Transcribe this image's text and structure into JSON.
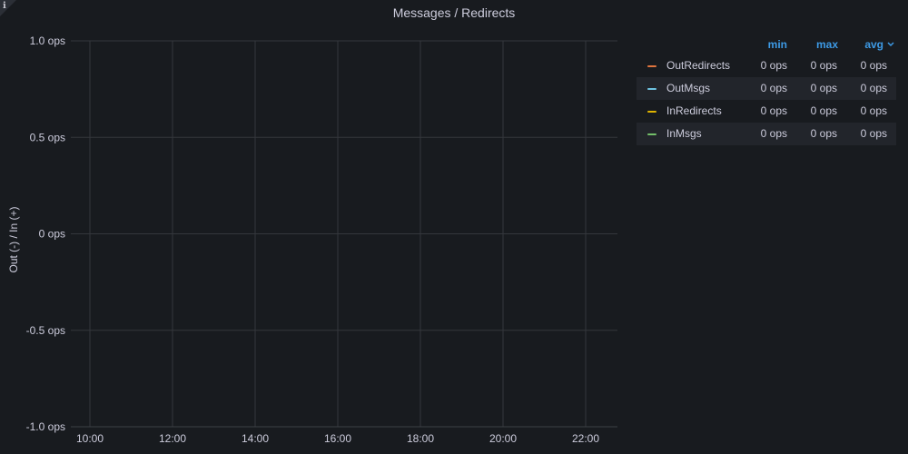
{
  "panel": {
    "title": "Messages / Redirects",
    "info_icon": "info-icon"
  },
  "legend": {
    "headers": {
      "min": "min",
      "max": "max",
      "avg": "avg"
    },
    "sort_icon": "chevron-down-icon",
    "rows": [
      {
        "name": "OutRedirects",
        "color": "#e0753e",
        "min": "0 ops",
        "max": "0 ops",
        "avg": "0 ops"
      },
      {
        "name": "OutMsgs",
        "color": "#6ec3e0",
        "min": "0 ops",
        "max": "0 ops",
        "avg": "0 ops"
      },
      {
        "name": "InRedirects",
        "color": "#e0b400",
        "min": "0 ops",
        "max": "0 ops",
        "avg": "0 ops"
      },
      {
        "name": "InMsgs",
        "color": "#73bf69",
        "min": "0 ops",
        "max": "0 ops",
        "avg": "0 ops"
      }
    ]
  },
  "chart_data": {
    "type": "line",
    "title": "Messages / Redirects",
    "ylabel": "Out (-) / In (+)",
    "xlabel": "",
    "ylim": [
      -1.0,
      1.0
    ],
    "y_ticks": [
      1.0,
      0.5,
      0,
      -0.5,
      -1.0
    ],
    "y_tick_labels": [
      "1.0 ops",
      "0.5 ops",
      "0 ops",
      "-0.5 ops",
      "-1.0 ops"
    ],
    "x_ticks": [
      "10:00",
      "12:00",
      "14:00",
      "16:00",
      "18:00",
      "20:00",
      "22:00"
    ],
    "grid": true,
    "legend_position": "right",
    "series": [
      {
        "name": "OutRedirects",
        "values": []
      },
      {
        "name": "OutMsgs",
        "values": []
      },
      {
        "name": "InRedirects",
        "values": []
      },
      {
        "name": "InMsgs",
        "values": []
      }
    ]
  }
}
